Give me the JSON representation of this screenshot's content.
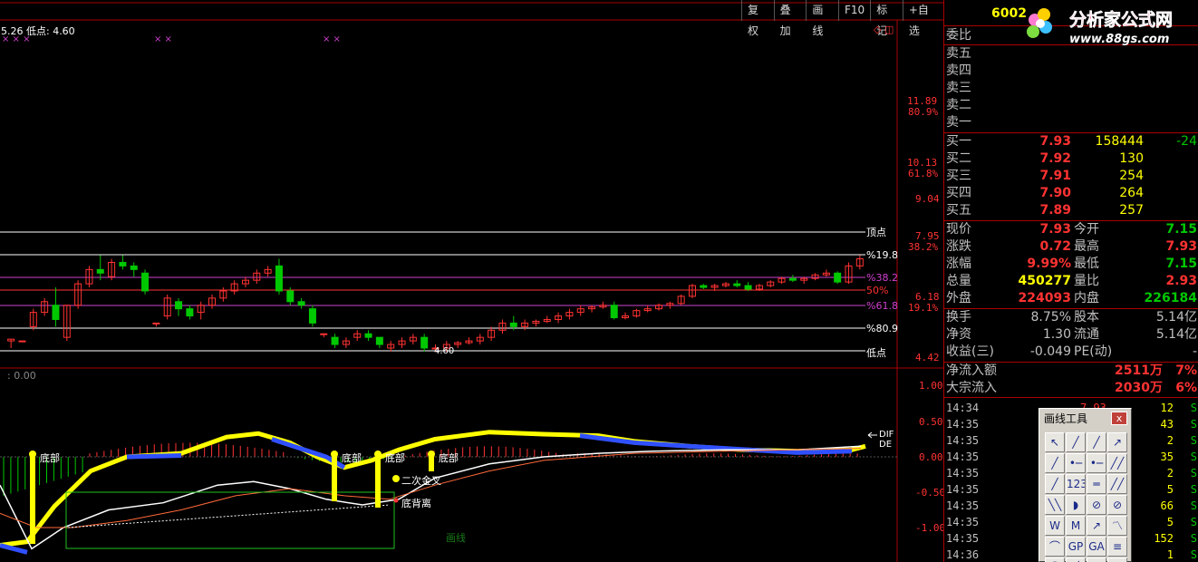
{
  "toolbar": {
    "buttons": [
      "复权",
      "叠加",
      "画线",
      "F10",
      "标记",
      "+自选"
    ]
  },
  "main_chart": {
    "info": "5.26  低点: 4.60",
    "price_axis": [
      "11.89",
      "80.9%",
      "10.13",
      "61.8%",
      "9.04",
      "7.95",
      "38.2%",
      "6.18",
      "19.1%",
      "4.42"
    ],
    "fib_labels": [
      "顶点",
      "%19.8",
      "%38.2",
      "50%",
      "%61.8",
      "%80.9",
      "低点"
    ],
    "low_mark": "4.60",
    "candles": [
      [
        4.9,
        4.95,
        4.7,
        4.95
      ],
      [
        4.9,
        4.9,
        4.9,
        4.9
      ],
      [
        5.3,
        5.8,
        5.2,
        5.7
      ],
      [
        5.7,
        6.1,
        5.6,
        6.0
      ],
      [
        5.9,
        6.4,
        5.3,
        5.5
      ],
      [
        5.0,
        5.9,
        4.9,
        5.9
      ],
      [
        5.9,
        6.6,
        5.8,
        6.5
      ],
      [
        6.5,
        7.0,
        6.4,
        6.9
      ],
      [
        6.9,
        7.3,
        6.6,
        6.8
      ],
      [
        6.7,
        7.2,
        6.6,
        7.1
      ],
      [
        7.1,
        7.3,
        6.9,
        7.0
      ],
      [
        7.0,
        7.1,
        6.7,
        6.9
      ],
      [
        6.8,
        6.9,
        6.2,
        6.3
      ],
      [
        5.4,
        5.4,
        5.3,
        5.4
      ],
      [
        5.6,
        6.2,
        5.5,
        6.1
      ],
      [
        6.0,
        6.1,
        5.6,
        5.8
      ],
      [
        5.8,
        5.9,
        5.5,
        5.6
      ],
      [
        5.7,
        6.0,
        5.5,
        5.9
      ],
      [
        5.9,
        6.2,
        5.8,
        6.1
      ],
      [
        6.1,
        6.4,
        6.0,
        6.3
      ],
      [
        6.3,
        6.6,
        6.2,
        6.5
      ],
      [
        6.5,
        6.7,
        6.4,
        6.6
      ],
      [
        6.6,
        6.9,
        6.5,
        6.8
      ],
      [
        6.8,
        7.0,
        6.7,
        6.9
      ],
      [
        7.0,
        7.2,
        6.2,
        6.3
      ],
      [
        6.3,
        6.4,
        5.9,
        6.0
      ],
      [
        6.0,
        6.1,
        5.8,
        5.9
      ],
      [
        5.8,
        5.9,
        5.3,
        5.4
      ],
      [
        5.1,
        5.1,
        5.0,
        5.1
      ],
      [
        5.0,
        5.1,
        4.7,
        4.8
      ],
      [
        4.8,
        5.0,
        4.7,
        4.9
      ],
      [
        5.0,
        5.2,
        4.9,
        5.1
      ],
      [
        5.1,
        5.2,
        4.9,
        5.0
      ],
      [
        5.0,
        5.0,
        4.7,
        4.8
      ],
      [
        4.7,
        4.9,
        4.6,
        4.8
      ],
      [
        4.8,
        5.0,
        4.7,
        4.9
      ],
      [
        4.9,
        5.1,
        4.8,
        5.0
      ],
      [
        5.0,
        5.1,
        4.6,
        4.7
      ],
      [
        4.7,
        4.8,
        4.6,
        4.7
      ],
      [
        4.7,
        4.9,
        4.6,
        4.8
      ],
      [
        4.8,
        4.9,
        4.7,
        4.85
      ],
      [
        4.85,
        5.0,
        4.8,
        4.9
      ],
      [
        4.9,
        5.1,
        4.8,
        5.0
      ],
      [
        5.0,
        5.3,
        4.9,
        5.2
      ],
      [
        5.2,
        5.5,
        5.1,
        5.4
      ],
      [
        5.4,
        5.6,
        5.2,
        5.3
      ],
      [
        5.3,
        5.5,
        5.2,
        5.4
      ],
      [
        5.4,
        5.5,
        5.3,
        5.45
      ],
      [
        5.45,
        5.6,
        5.4,
        5.5
      ],
      [
        5.5,
        5.7,
        5.4,
        5.6
      ],
      [
        5.6,
        5.8,
        5.5,
        5.7
      ],
      [
        5.7,
        5.9,
        5.6,
        5.8
      ],
      [
        5.8,
        5.9,
        5.7,
        5.85
      ],
      [
        5.85,
        6.0,
        5.8,
        5.9
      ],
      [
        5.9,
        6.0,
        5.5,
        5.55
      ],
      [
        5.55,
        5.7,
        5.5,
        5.6
      ],
      [
        5.6,
        5.8,
        5.55,
        5.75
      ],
      [
        5.75,
        5.9,
        5.7,
        5.8
      ],
      [
        5.8,
        5.95,
        5.75,
        5.9
      ],
      [
        5.9,
        6.0,
        5.8,
        5.95
      ],
      [
        5.95,
        6.2,
        5.9,
        6.15
      ],
      [
        6.15,
        6.5,
        6.1,
        6.45
      ],
      [
        6.45,
        6.5,
        6.35,
        6.4
      ],
      [
        6.4,
        6.5,
        6.3,
        6.45
      ],
      [
        6.45,
        6.55,
        6.4,
        6.5
      ],
      [
        6.5,
        6.6,
        6.4,
        6.45
      ],
      [
        6.45,
        6.55,
        6.3,
        6.35
      ],
      [
        6.35,
        6.5,
        6.3,
        6.45
      ],
      [
        6.45,
        6.6,
        6.4,
        6.55
      ],
      [
        6.55,
        6.7,
        6.5,
        6.65
      ],
      [
        6.65,
        6.75,
        6.55,
        6.6
      ],
      [
        6.6,
        6.7,
        6.5,
        6.65
      ],
      [
        6.65,
        6.8,
        6.6,
        6.75
      ],
      [
        6.75,
        6.9,
        6.7,
        6.8
      ],
      [
        6.8,
        6.85,
        6.5,
        6.55
      ],
      [
        6.55,
        7.1,
        6.5,
        7.0
      ],
      [
        7.0,
        7.3,
        6.9,
        7.2
      ]
    ]
  },
  "macd": {
    "info": ": 0.00",
    "axis": [
      "1.00",
      "0.50",
      "0.00",
      "-0.50",
      "-1.00"
    ],
    "labels": [
      "底部",
      "底部",
      "底部",
      "底部",
      "二次金叉",
      "底背离",
      "DIF",
      "DE"
    ],
    "watermark": "画线"
  },
  "quote": {
    "code": "6002",
    "weibi_label": "委比",
    "sell": [
      {
        "label": "卖五"
      },
      {
        "label": "卖四"
      },
      {
        "label": "卖三"
      },
      {
        "label": "卖二"
      },
      {
        "label": "卖一"
      }
    ],
    "buy": [
      {
        "label": "买一",
        "price": "7.93",
        "vol": "158444",
        "chg": "-24"
      },
      {
        "label": "买二",
        "price": "7.92",
        "vol": "130",
        "chg": ""
      },
      {
        "label": "买三",
        "price": "7.91",
        "vol": "254",
        "chg": ""
      },
      {
        "label": "买四",
        "price": "7.90",
        "vol": "264",
        "chg": ""
      },
      {
        "label": "买五",
        "price": "7.89",
        "vol": "257",
        "chg": ""
      }
    ],
    "stats": [
      {
        "l1": "现价",
        "v1": "7.93",
        "l2": "今开",
        "v2": "7.15"
      },
      {
        "l1": "涨跌",
        "v1": "0.72",
        "l2": "最高",
        "v2": "7.93"
      },
      {
        "l1": "涨幅",
        "v1": "9.99%",
        "l2": "最低",
        "v2": "7.15"
      },
      {
        "l1": "总量",
        "v1": "450277",
        "l2": "量比",
        "v2": "2.93"
      },
      {
        "l1": "外盘",
        "v1": "224093",
        "l2": "内盘",
        "v2": "226184"
      }
    ],
    "stats2": [
      {
        "l1": "换手",
        "v1": "8.75%",
        "l2": "股本",
        "v2": "5.14亿"
      },
      {
        "l1": "净资",
        "v1": "1.30",
        "l2": "流通",
        "v2": "5.14亿"
      },
      {
        "l1": "收益(三)",
        "v1": "-0.049",
        "l2": "PE(动)",
        "v2": "-"
      }
    ],
    "flow": [
      {
        "l": "净流入额",
        "v": "2511万",
        "p": "7%"
      },
      {
        "l": "大宗流入",
        "v": "2030万",
        "p": "6%"
      }
    ],
    "trades": [
      {
        "t": "14:34",
        "p": "7.93",
        "v": "12",
        "s": "S"
      },
      {
        "t": "14:35",
        "p": "",
        "v": "43",
        "s": "S"
      },
      {
        "t": "14:35",
        "p": "",
        "v": "2",
        "s": "S"
      },
      {
        "t": "14:35",
        "p": "",
        "v": "35",
        "s": "S"
      },
      {
        "t": "14:35",
        "p": "",
        "v": "2",
        "s": "S"
      },
      {
        "t": "14:35",
        "p": "",
        "v": "5",
        "s": "S"
      },
      {
        "t": "14:35",
        "p": "",
        "v": "66",
        "s": "S"
      },
      {
        "t": "14:35",
        "p": "",
        "v": "5",
        "s": "S"
      },
      {
        "t": "14:35",
        "p": "",
        "v": "152",
        "s": "S"
      },
      {
        "t": "14:36",
        "p": "",
        "v": "1",
        "s": "S"
      }
    ]
  },
  "draw_tools": {
    "title": "画线工具",
    "close": "x",
    "tools": [
      "↖",
      "╱",
      "╱",
      "↗",
      "╱",
      "•─",
      "•─",
      "╱╱",
      "╱",
      "123",
      "═",
      "╱╱",
      "╲╲",
      "◗",
      "⊘",
      "⊘",
      "W",
      "M",
      "↗",
      "〽",
      "⌒",
      "GP",
      "GA",
      "≡",
      "⌒",
      "╱",
      "≡",
      "≡"
    ]
  },
  "logo": {
    "name": "分析家公式网",
    "url": "www.88gs.com"
  },
  "colors": {
    "up": "#ff3232",
    "down": "#00c800",
    "axis": "#ff3232",
    "fib": "#ffffff",
    "fib_mid": "#cc44cc"
  }
}
